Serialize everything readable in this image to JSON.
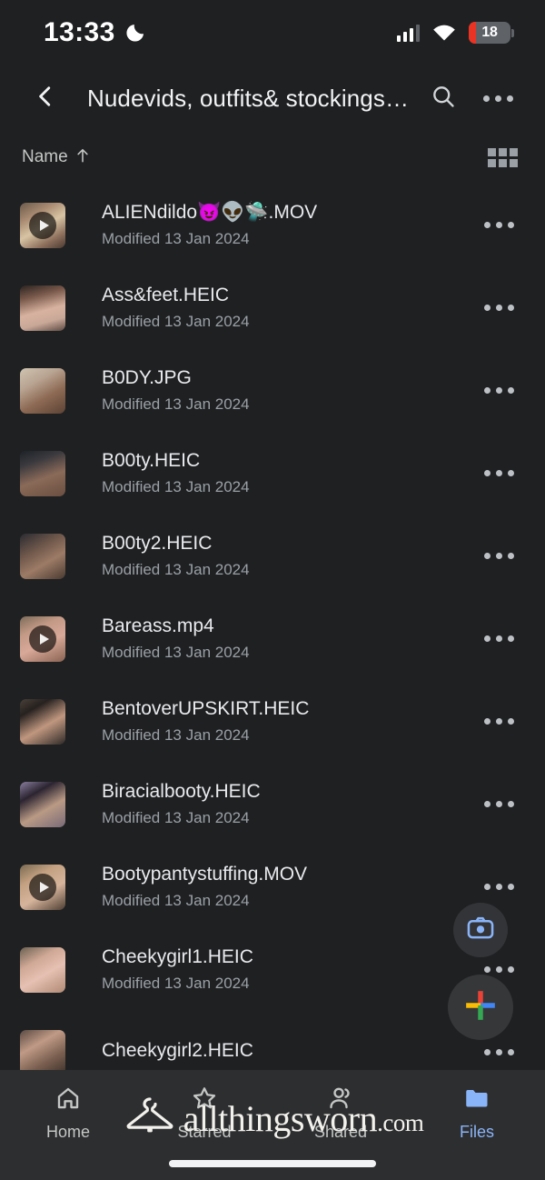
{
  "status_bar": {
    "time": "13:33",
    "dnd_icon": "moon-icon",
    "signal_icon": "cellular-signal-icon",
    "wifi_icon": "wifi-icon",
    "battery_level": "18",
    "battery_color": "#ea3323"
  },
  "app_bar": {
    "back_icon": "chevron-left-icon",
    "title": "Nudevids, outfits& stockings °…",
    "search_icon": "search-icon",
    "overflow_icon": "more-horizontal-icon"
  },
  "sort_bar": {
    "sort_label": "Name",
    "sort_direction_icon": "arrow-up-icon",
    "view_toggle_icon": "grid-view-icon"
  },
  "files": [
    {
      "name": "ALIENdildo😈👽🛸.MOV",
      "modified": "Modified 13 Jan 2024",
      "type": "video",
      "thumb": "linear-gradient(150deg,#6b5a4a 0%,#a98b72 28%,#d8c4a4 52%,#8d6f5c 78%,#4a3a30 100%)"
    },
    {
      "name": "Ass&feet.HEIC",
      "modified": "Modified 13 Jan 2024",
      "type": "image",
      "thumb": "linear-gradient(165deg,#2b2420 0%,#7a5a4c 26%,#d8b2a0 55%,#c9a898 76%,#5d4a42 100%)"
    },
    {
      "name": "B0DY.JPG",
      "modified": "Modified 13 Jan 2024",
      "type": "image",
      "thumb": "linear-gradient(150deg,#cfc4b0 0%,#b8a391 32%,#8d6a54 62%,#5c4234 100%)"
    },
    {
      "name": "B00ty.HEIC",
      "modified": "Modified 13 Jan 2024",
      "type": "image",
      "thumb": "linear-gradient(160deg,#1d2228 0%,#3b3a3e 26%,#8a6a58 58%,#6a4e40 100%)"
    },
    {
      "name": "B00ty2.HEIC",
      "modified": "Modified 13 Jan 2024",
      "type": "image",
      "thumb": "linear-gradient(150deg,#2a2b31 0%,#6d564a 34%,#9d7b66 62%,#4a3a31 100%)"
    },
    {
      "name": "Bareass.mp4",
      "modified": "Modified 13 Jan 2024",
      "type": "video",
      "thumb": "linear-gradient(155deg,#7d6c5a 0%,#c39a86 30%,#d8a898 58%,#8a6352 100%)"
    },
    {
      "name": "BentoverUPSKIRT.HEIC",
      "modified": "Modified 13 Jan 2024",
      "type": "image",
      "thumb": "linear-gradient(150deg,#4a4038 0%,#26211f 24%,#c0977f 58%,#2e2a28 100%)"
    },
    {
      "name": "Biracialbooty.HEIC",
      "modified": "Modified 13 Jan 2024",
      "type": "image",
      "thumb": "linear-gradient(150deg,#8a7fa0 0%,#2b2430 28%,#b99a84 60%,#7a6a78 100%)"
    },
    {
      "name": "Bootypantystuffing.MOV",
      "modified": "Modified 13 Jan 2024",
      "type": "video",
      "thumb": "linear-gradient(150deg,#7a6a52 0%,#c2a080 30%,#d6b49c 60%,#4e3e32 100%)"
    },
    {
      "name": "Cheekygirl1.HEIC",
      "modified": "Modified 13 Jan 2024",
      "type": "image",
      "thumb": "linear-gradient(150deg,#6a6050 0%,#d0a896 32%,#e6c0b2 58%,#b08a74 100%)"
    },
    {
      "name": "Cheekygirl2.HEIC",
      "modified": "",
      "type": "image",
      "thumb": "linear-gradient(150deg,#5a4a42 0%,#c09a86 34%,#7a5f50 66%,#3a2e28 100%)"
    }
  ],
  "row_menu_icon": "more-horizontal-icon",
  "fab": {
    "scan_icon": "camera-scan-icon",
    "scan_color": "#8ab4f8",
    "add_icon": "plus-icon",
    "add_colors": [
      "#ea4335",
      "#fbbc04",
      "#4285f4",
      "#34a853"
    ]
  },
  "bottom_nav": [
    {
      "label": "Home",
      "icon": "home-icon",
      "active": false
    },
    {
      "label": "Starred",
      "icon": "star-icon",
      "active": false
    },
    {
      "label": "Shared",
      "icon": "people-icon",
      "active": false
    },
    {
      "label": "Files",
      "icon": "folder-icon",
      "active": true
    }
  ],
  "watermark": {
    "logo_icon": "clothes-hanger-icon",
    "name": "allthingsworn",
    "tld": ".com"
  }
}
